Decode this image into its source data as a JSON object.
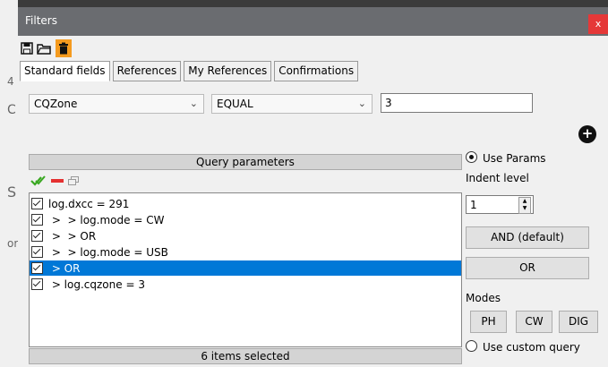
{
  "background": {
    "left_letters": [
      "4",
      "C",
      "S",
      "or"
    ]
  },
  "window": {
    "title": "Filters",
    "close_glyph": "x"
  },
  "toolbar": {
    "icons": [
      "save-icon",
      "open-folder-icon",
      "delete-icon"
    ]
  },
  "tabs": [
    {
      "label": "Standard fields",
      "active": true
    },
    {
      "label": "References",
      "active": false
    },
    {
      "label": "My References",
      "active": false
    },
    {
      "label": "Confirmations",
      "active": false
    }
  ],
  "filter": {
    "field": "CQZone",
    "operator": "EQUAL",
    "value": "3"
  },
  "query": {
    "header": "Query parameters",
    "rows": [
      {
        "text": "log.dxcc = 291",
        "checked": true,
        "selected": false
      },
      {
        "text": " >  > log.mode = CW",
        "checked": true,
        "selected": false
      },
      {
        "text": " >  > OR",
        "checked": true,
        "selected": false
      },
      {
        "text": " >  > log.mode = USB",
        "checked": true,
        "selected": false
      },
      {
        "text": " > OR",
        "checked": true,
        "selected": true
      },
      {
        "text": " > log.cqzone = 3",
        "checked": true,
        "selected": false
      }
    ],
    "status": "6 items selected"
  },
  "side": {
    "use_params": "Use Params",
    "indent_label": "Indent level",
    "indent_value": "1",
    "and_button": "AND (default)",
    "or_button": "OR",
    "modes_label": "Modes",
    "mode_ph": "PH",
    "mode_cw": "CW",
    "mode_dig": "DIG",
    "custom_query": "Use custom query"
  },
  "colors": {
    "selection": "#0078d7",
    "titlebar": "#6a6c70",
    "close": "#e53838",
    "delete_icon_bg": "#f59b1f",
    "check_green": "#3aa822",
    "remove_red": "#e53030"
  }
}
